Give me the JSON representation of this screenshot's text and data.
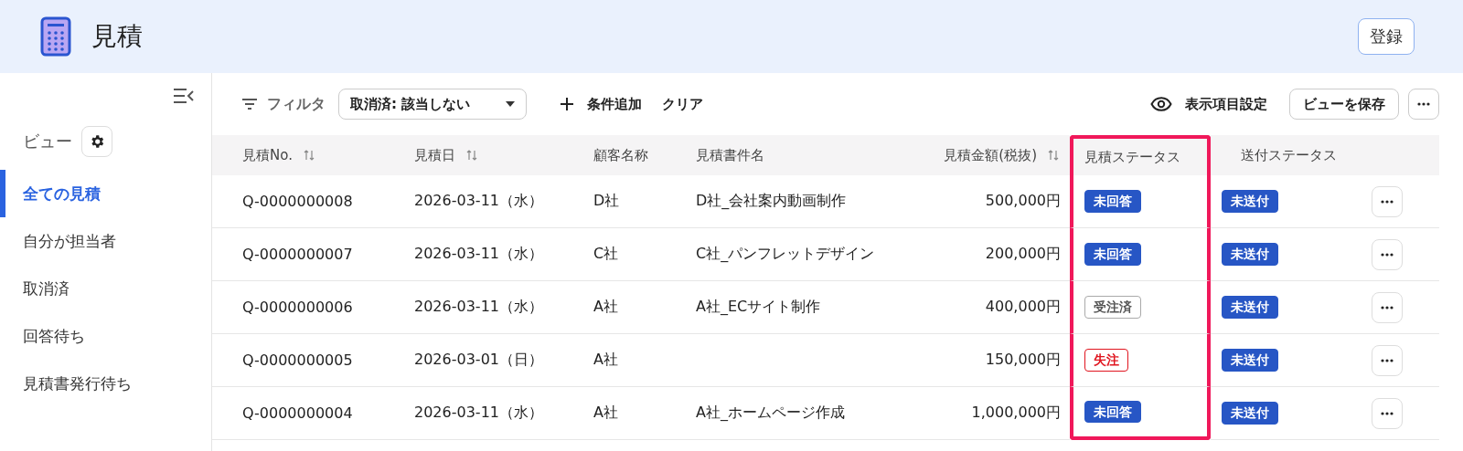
{
  "header": {
    "title": "見積",
    "register_button": "登録"
  },
  "sidebar": {
    "views_label": "ビュー",
    "items": [
      {
        "label": "全ての見積",
        "selected": true
      },
      {
        "label": "自分が担当者",
        "selected": false
      },
      {
        "label": "取消済",
        "selected": false
      },
      {
        "label": "回答待ち",
        "selected": false
      },
      {
        "label": "見積書発行待ち",
        "selected": false
      }
    ]
  },
  "toolbar": {
    "filter_label": "フィルタ",
    "filter_value": "取消済: 該当しない",
    "add_condition": "条件追加",
    "clear": "クリア",
    "display_settings": "表示項目設定",
    "save_view": "ビューを保存"
  },
  "table": {
    "columns": [
      {
        "label": "見積No.",
        "sortable": true,
        "highlighted": false
      },
      {
        "label": "見積日",
        "sortable": true,
        "highlighted": false
      },
      {
        "label": "顧客名称",
        "sortable": false,
        "highlighted": false
      },
      {
        "label": "見積書件名",
        "sortable": false,
        "highlighted": false
      },
      {
        "label": "見積金額(税抜)",
        "sortable": true,
        "highlighted": false
      },
      {
        "label": "見積ステータス",
        "sortable": false,
        "highlighted": true
      },
      {
        "label": "送付ステータス",
        "sortable": false,
        "highlighted": false
      }
    ],
    "rows": [
      {
        "number": "Q-0000000008",
        "date": "2026-03-11（水）",
        "customer": "D社",
        "subject": "D社_会社案内動画制作",
        "amount": "500,000円",
        "quote_status": {
          "label": "未回答",
          "kind": "filled"
        },
        "send_status": {
          "label": "未送付",
          "kind": "filled"
        }
      },
      {
        "number": "Q-0000000007",
        "date": "2026-03-11（水）",
        "customer": "C社",
        "subject": "C社_パンフレットデザイン",
        "amount": "200,000円",
        "quote_status": {
          "label": "未回答",
          "kind": "filled"
        },
        "send_status": {
          "label": "未送付",
          "kind": "filled"
        }
      },
      {
        "number": "Q-0000000006",
        "date": "2026-03-11（水）",
        "customer": "A社",
        "subject": "A社_ECサイト制作",
        "amount": "400,000円",
        "quote_status": {
          "label": "受注済",
          "kind": "neutral"
        },
        "send_status": {
          "label": "未送付",
          "kind": "filled"
        }
      },
      {
        "number": "Q-0000000005",
        "date": "2026-03-01（日）",
        "customer": "A社",
        "subject": "",
        "amount": "150,000円",
        "quote_status": {
          "label": "失注",
          "kind": "alert"
        },
        "send_status": {
          "label": "未送付",
          "kind": "filled"
        }
      },
      {
        "number": "Q-0000000004",
        "date": "2026-03-11（水）",
        "customer": "A社",
        "subject": "A社_ホームページ作成",
        "amount": "1,000,000円",
        "quote_status": {
          "label": "未回答",
          "kind": "filled"
        },
        "send_status": {
          "label": "未送付",
          "kind": "filled"
        }
      }
    ]
  }
}
